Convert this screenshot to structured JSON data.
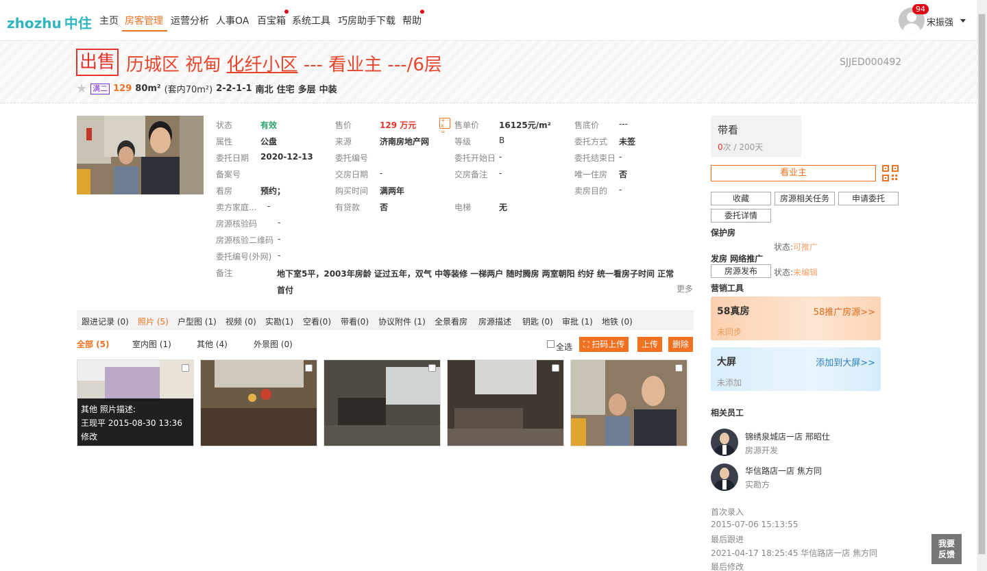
{
  "nav": {
    "logo_en": "zhozhu",
    "logo_cn": "中住",
    "items": [
      "主页",
      "房客管理",
      "运营分析",
      "人事OA",
      "百宝箱",
      "系统工具",
      "巧房助手下载",
      "帮助"
    ],
    "badge": "94",
    "user": "宋振强"
  },
  "title": {
    "tag": "出售",
    "district": "历城区 祝甸",
    "community": "化纤小区",
    "rest": "--- 看业主 ---/6层",
    "code": "SJJED000492",
    "man_tag": "满二",
    "price": "129",
    "area": "80m²",
    "area_inner": "(套内70m²)",
    "layout": "2-2-1-1",
    "facing": "南北",
    "usage": "住宅",
    "floor_type": "多层",
    "decoration": "中装"
  },
  "info": {
    "col1": [
      {
        "k": "状态",
        "v": "有效"
      },
      {
        "k": "属性",
        "v": "公盘"
      },
      {
        "k": "委托日期",
        "v": "2020-12-13"
      },
      {
        "k": "备案号",
        "v": ""
      },
      {
        "k": "看房",
        "v": "预约；"
      },
      {
        "k": "卖方家庭...",
        "v": "-"
      },
      {
        "k": "房源核验码",
        "v": "-"
      },
      {
        "k": "房源核验二维码",
        "v": "-"
      },
      {
        "k": "委托编号(外网)",
        "v": "-"
      }
    ],
    "col2": [
      {
        "k": "售价",
        "v": "129 万元"
      },
      {
        "k": "来源",
        "v": "济南房地产网"
      },
      {
        "k": "委托编号",
        "v": ""
      },
      {
        "k": "交房日期",
        "v": "-"
      },
      {
        "k": "购买时间",
        "v": "满两年"
      },
      {
        "k": "有贷款",
        "v": "否"
      }
    ],
    "col3": [
      {
        "k": "售单价",
        "v": "16125元/m²"
      },
      {
        "k": "等级",
        "v": "B"
      },
      {
        "k": "委托开始日",
        "v": "-"
      },
      {
        "k": "交房备注",
        "v": "-"
      },
      {
        "k": "",
        "v": ""
      },
      {
        "k": "电梯",
        "v": "无"
      }
    ],
    "col4": [
      {
        "k": "售底价",
        "v": "---"
      },
      {
        "k": "委托方式",
        "v": "未签"
      },
      {
        "k": "委托结束日",
        "v": "-"
      },
      {
        "k": "唯一住房",
        "v": "否"
      },
      {
        "k": "卖房目的",
        "v": "-"
      }
    ],
    "remark_label": "备注",
    "remark": "地下室5平，2003年房龄 证过五年，双气 中等装修 一梯两户 随时腾房 两室朝阳 约好 统一看房子时间 正常首付",
    "more": "更多"
  },
  "tabs": [
    "跟进记录 (0)",
    "照片 (5)",
    "户型图 (1)",
    "视频 (0)",
    "实勘(1)",
    "空看(0)",
    "带看(0)",
    "协议附件 (1)",
    "全景看房",
    "房源描述",
    "钥匙 (0)",
    "审批 (1)",
    "地铁 (0)"
  ],
  "subtabs": [
    "全部 (5)",
    "室内图 (1)",
    "其他 (4)",
    "外景图 (0)"
  ],
  "photo_actions": {
    "select_all": "全选",
    "scan_upload": "扫码上传",
    "upload": "上传",
    "delete": "删除"
  },
  "photo_overlay": {
    "line1": "其他   照片描述:",
    "line2": "王现平 2015-08-30 13:36",
    "line3": "修改"
  },
  "right": {
    "daikan_title": "带看",
    "daikan_count": "0",
    "daikan_total": "次 / 200天",
    "look_owner": "看业主",
    "btns": [
      "收藏",
      "房源相关任务",
      "申请委托",
      "委托详情"
    ],
    "protect": "保护房",
    "protect_status_label": "状态:",
    "protect_status": "可推广",
    "publish_label": "发房 网络推广",
    "publish_btn": "房源发布",
    "publish_status_label": "状态:",
    "publish_status": "未编辑",
    "marketing": "营销工具",
    "card58_title": "58真房",
    "card58_link": "58推广房源>>",
    "card58_status": "未同步",
    "bigscreen_title": "大屏",
    "bigscreen_link": "添加到大屏>>",
    "bigscreen_status": "未添加",
    "staff_title": "相关员工",
    "staff": [
      {
        "name": "锦绣泉城店一店 邢昭仕",
        "role": "房源开发"
      },
      {
        "name": "华信路店一店 焦方同",
        "role": "实勘方"
      }
    ],
    "first_entry_label": "首次录入",
    "first_entry": "2015-07-06 15:13:55",
    "last_follow_label": "最后跟进",
    "last_follow": "2021-04-17 18:25:45 华信路店一店 焦方同",
    "last_modify_label": "最后修改"
  },
  "feedback": {
    "l1": "我要",
    "l2": "反馈"
  }
}
